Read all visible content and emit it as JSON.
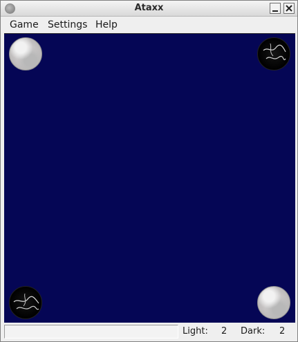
{
  "window": {
    "title": "Ataxx"
  },
  "menubar": {
    "items": [
      {
        "label": "Game"
      },
      {
        "label": "Settings"
      },
      {
        "label": "Help"
      }
    ]
  },
  "board": {
    "background_color": "#050655",
    "pieces": [
      {
        "position": "top-left",
        "color": "light"
      },
      {
        "position": "top-right",
        "color": "dark"
      },
      {
        "position": "bottom-left",
        "color": "dark"
      },
      {
        "position": "bottom-right",
        "color": "light"
      }
    ]
  },
  "status": {
    "message": "",
    "light_label": "Light:",
    "light_count": "2",
    "dark_label": "Dark:",
    "dark_count": "2"
  }
}
